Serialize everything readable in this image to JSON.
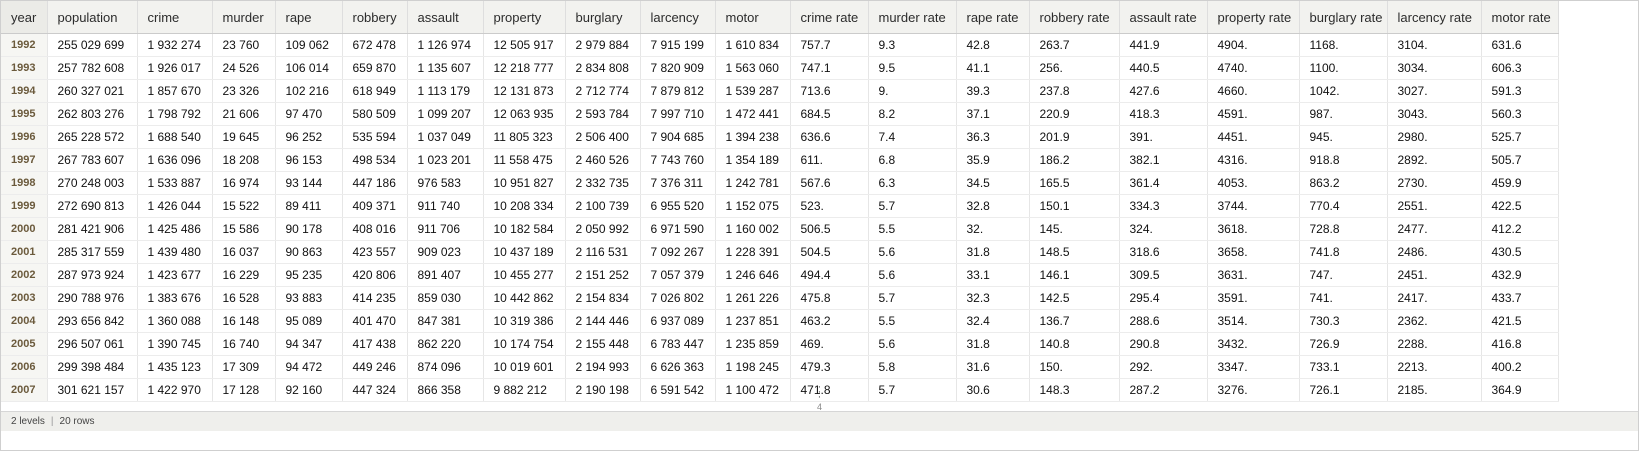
{
  "table": {
    "columns": [
      "year",
      "population",
      "crime",
      "murder",
      "rape",
      "robbery",
      "assault",
      "property",
      "burglary",
      "larcency",
      "motor",
      "crime rate",
      "murder rate",
      "rape rate",
      "robbery rate",
      "assault rate",
      "property rate",
      "burglary rate",
      "larcency rate",
      "motor rate"
    ],
    "rows": [
      [
        "1992",
        "255 029 699",
        "1 932 274",
        "23 760",
        "109 062",
        "672 478",
        "1 126 974",
        "12 505 917",
        "2 979 884",
        "7 915 199",
        "1 610 834",
        "757.7",
        "9.3",
        "42.8",
        "263.7",
        "441.9",
        "4904.",
        "1168.",
        "3104.",
        "631.6"
      ],
      [
        "1993",
        "257 782 608",
        "1 926 017",
        "24 526",
        "106 014",
        "659 870",
        "1 135 607",
        "12 218 777",
        "2 834 808",
        "7 820 909",
        "1 563 060",
        "747.1",
        "9.5",
        "41.1",
        "256.",
        "440.5",
        "4740.",
        "1100.",
        "3034.",
        "606.3"
      ],
      [
        "1994",
        "260 327 021",
        "1 857 670",
        "23 326",
        "102 216",
        "618 949",
        "1 113 179",
        "12 131 873",
        "2 712 774",
        "7 879 812",
        "1 539 287",
        "713.6",
        "9.",
        "39.3",
        "237.8",
        "427.6",
        "4660.",
        "1042.",
        "3027.",
        "591.3"
      ],
      [
        "1995",
        "262 803 276",
        "1 798 792",
        "21 606",
        "97 470",
        "580 509",
        "1 099 207",
        "12 063 935",
        "2 593 784",
        "7 997 710",
        "1 472 441",
        "684.5",
        "8.2",
        "37.1",
        "220.9",
        "418.3",
        "4591.",
        "987.",
        "3043.",
        "560.3"
      ],
      [
        "1996",
        "265 228 572",
        "1 688 540",
        "19 645",
        "96 252",
        "535 594",
        "1 037 049",
        "11 805 323",
        "2 506 400",
        "7 904 685",
        "1 394 238",
        "636.6",
        "7.4",
        "36.3",
        "201.9",
        "391.",
        "4451.",
        "945.",
        "2980.",
        "525.7"
      ],
      [
        "1997",
        "267 783 607",
        "1 636 096",
        "18 208",
        "96 153",
        "498 534",
        "1 023 201",
        "11 558 475",
        "2 460 526",
        "7 743 760",
        "1 354 189",
        "611.",
        "6.8",
        "35.9",
        "186.2",
        "382.1",
        "4316.",
        "918.8",
        "2892.",
        "505.7"
      ],
      [
        "1998",
        "270 248 003",
        "1 533 887",
        "16 974",
        "93 144",
        "447 186",
        "976 583",
        "10 951 827",
        "2 332 735",
        "7 376 311",
        "1 242 781",
        "567.6",
        "6.3",
        "34.5",
        "165.5",
        "361.4",
        "4053.",
        "863.2",
        "2730.",
        "459.9"
      ],
      [
        "1999",
        "272 690 813",
        "1 426 044",
        "15 522",
        "89 411",
        "409 371",
        "911 740",
        "10 208 334",
        "2 100 739",
        "6 955 520",
        "1 152 075",
        "523.",
        "5.7",
        "32.8",
        "150.1",
        "334.3",
        "3744.",
        "770.4",
        "2551.",
        "422.5"
      ],
      [
        "2000",
        "281 421 906",
        "1 425 486",
        "15 586",
        "90 178",
        "408 016",
        "911 706",
        "10 182 584",
        "2 050 992",
        "6 971 590",
        "1 160 002",
        "506.5",
        "5.5",
        "32.",
        "145.",
        "324.",
        "3618.",
        "728.8",
        "2477.",
        "412.2"
      ],
      [
        "2001",
        "285 317 559",
        "1 439 480",
        "16 037",
        "90 863",
        "423 557",
        "909 023",
        "10 437 189",
        "2 116 531",
        "7 092 267",
        "1 228 391",
        "504.5",
        "5.6",
        "31.8",
        "148.5",
        "318.6",
        "3658.",
        "741.8",
        "2486.",
        "430.5"
      ],
      [
        "2002",
        "287 973 924",
        "1 423 677",
        "16 229",
        "95 235",
        "420 806",
        "891 407",
        "10 455 277",
        "2 151 252",
        "7 057 379",
        "1 246 646",
        "494.4",
        "5.6",
        "33.1",
        "146.1",
        "309.5",
        "3631.",
        "747.",
        "2451.",
        "432.9"
      ],
      [
        "2003",
        "290 788 976",
        "1 383 676",
        "16 528",
        "93 883",
        "414 235",
        "859 030",
        "10 442 862",
        "2 154 834",
        "7 026 802",
        "1 261 226",
        "475.8",
        "5.7",
        "32.3",
        "142.5",
        "295.4",
        "3591.",
        "741.",
        "2417.",
        "433.7"
      ],
      [
        "2004",
        "293 656 842",
        "1 360 088",
        "16 148",
        "95 089",
        "401 470",
        "847 381",
        "10 319 386",
        "2 144 446",
        "6 937 089",
        "1 237 851",
        "463.2",
        "5.5",
        "32.4",
        "136.7",
        "288.6",
        "3514.",
        "730.3",
        "2362.",
        "421.5"
      ],
      [
        "2005",
        "296 507 061",
        "1 390 745",
        "16 740",
        "94 347",
        "417 438",
        "862 220",
        "10 174 754",
        "2 155 448",
        "6 783 447",
        "1 235 859",
        "469.",
        "5.6",
        "31.8",
        "140.8",
        "290.8",
        "3432.",
        "726.9",
        "2288.",
        "416.8"
      ],
      [
        "2006",
        "299 398 484",
        "1 435 123",
        "17 309",
        "94 472",
        "449 246",
        "874 096",
        "10 019 601",
        "2 194 993",
        "6 626 363",
        "1 198 245",
        "479.3",
        "5.8",
        "31.6",
        "150.",
        "292.",
        "3347.",
        "733.1",
        "2213.",
        "400.2"
      ],
      [
        "2007",
        "301 621 157",
        "1 422 970",
        "17 128",
        "92 160",
        "447 324",
        "866 358",
        "9 882 212",
        "2 190 198",
        "6 591 542",
        "1 100 472",
        "471.8",
        "5.7",
        "30.6",
        "148.3",
        "287.2",
        "3276.",
        "726.1",
        "2185.",
        "364.9"
      ]
    ]
  },
  "more_rows_count": "4",
  "status": {
    "levels": "2 levels",
    "rows": "20 rows"
  }
}
